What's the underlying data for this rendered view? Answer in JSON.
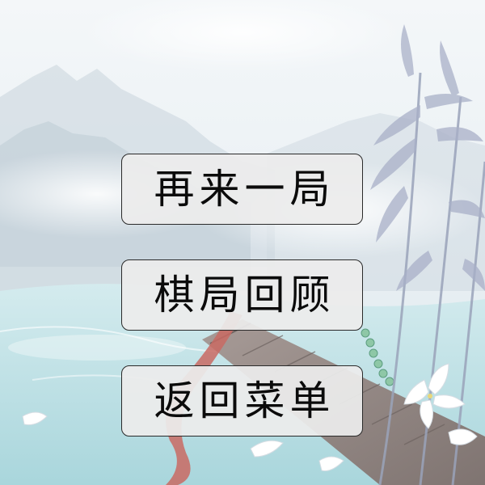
{
  "menu": {
    "play_again_label": "再来一局",
    "review_game_label": "棋局回顾",
    "back_to_menu_label": "返回菜单"
  },
  "colors": {
    "button_background": "#ececec",
    "button_border": "#2a2a2a",
    "button_text": "#0b0b0b",
    "sky": "#eef3f6",
    "water": "#bfe0e4"
  }
}
